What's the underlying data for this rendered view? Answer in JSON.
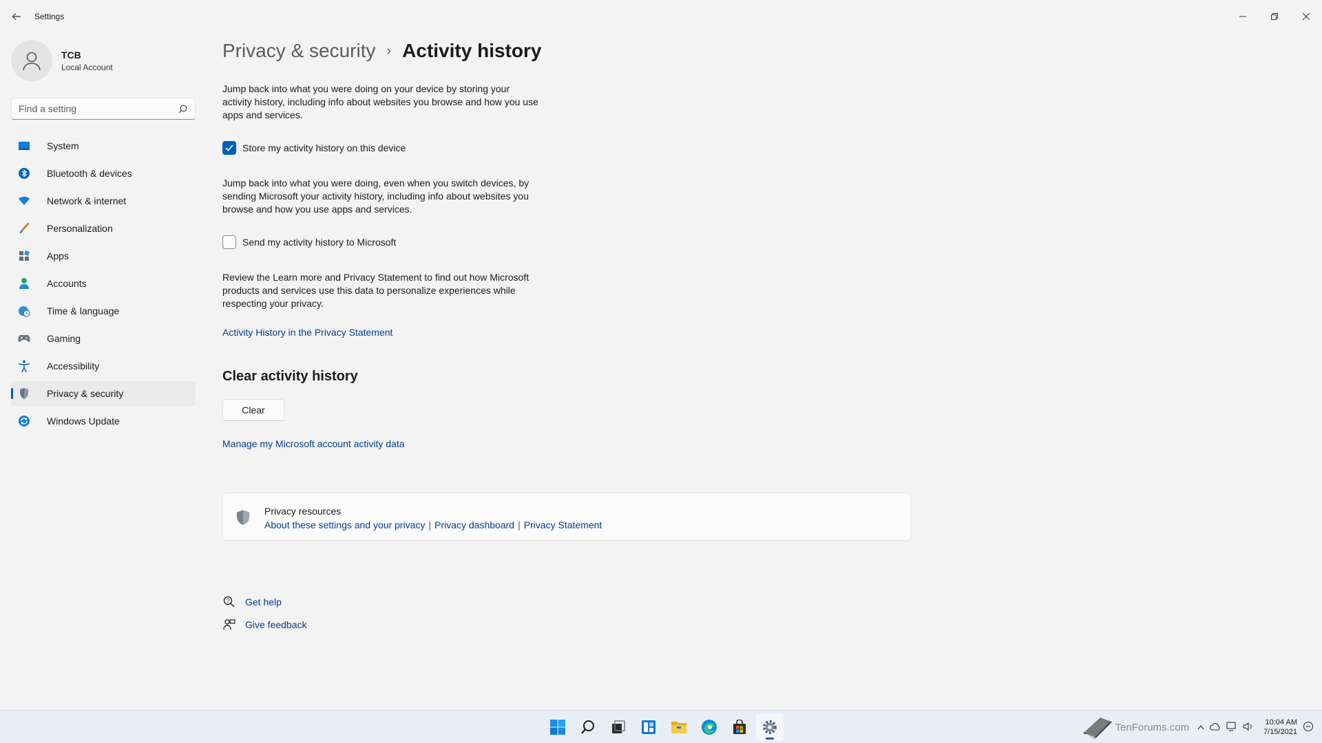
{
  "window": {
    "title": "Settings"
  },
  "profile": {
    "name": "TCB",
    "subtitle": "Local Account"
  },
  "search": {
    "placeholder": "Find a setting"
  },
  "sidebar": {
    "items": [
      {
        "label": "System",
        "icon": "system-icon",
        "active": false
      },
      {
        "label": "Bluetooth & devices",
        "icon": "bluetooth-icon",
        "active": false
      },
      {
        "label": "Network & internet",
        "icon": "wifi-icon",
        "active": false
      },
      {
        "label": "Personalization",
        "icon": "brush-icon",
        "active": false
      },
      {
        "label": "Apps",
        "icon": "apps-icon",
        "active": false
      },
      {
        "label": "Accounts",
        "icon": "accounts-icon",
        "active": false
      },
      {
        "label": "Time & language",
        "icon": "globe-clock-icon",
        "active": false
      },
      {
        "label": "Gaming",
        "icon": "gamepad-icon",
        "active": false
      },
      {
        "label": "Accessibility",
        "icon": "accessibility-icon",
        "active": false
      },
      {
        "label": "Privacy & security",
        "icon": "shield-icon",
        "active": true
      },
      {
        "label": "Windows Update",
        "icon": "update-icon",
        "active": false
      }
    ]
  },
  "breadcrumb": {
    "parent": "Privacy & security",
    "separator": "›",
    "current": "Activity history"
  },
  "main": {
    "para1": "Jump back into what you were doing on your device by storing your activity history, including info about websites you browse and how you use apps and services.",
    "checkbox1": {
      "label": "Store my activity history on this device",
      "checked": true
    },
    "para2": "Jump back into what you were doing, even when you switch devices, by sending Microsoft your activity history, including info about websites you browse and how you use apps and services.",
    "checkbox2": {
      "label": "Send my activity history to Microsoft",
      "checked": false
    },
    "para3": "Review the Learn more and Privacy Statement to find out how Microsoft products and services use this data to personalize experiences while respecting your privacy.",
    "privacy_link": "Activity History in the Privacy Statement",
    "clear_section_title": "Clear activity history",
    "clear_button": "Clear",
    "manage_link": "Manage my Microsoft account activity data"
  },
  "resources": {
    "title": "Privacy resources",
    "links": [
      "About these settings and your privacy",
      "Privacy dashboard",
      "Privacy Statement"
    ],
    "separator": "|"
  },
  "help": {
    "get_help": "Get help",
    "give_feedback": "Give feedback"
  },
  "taskbar": {
    "apps": [
      "start-icon",
      "search-icon",
      "task-view-icon",
      "widgets-icon",
      "file-explorer-icon",
      "edge-icon",
      "store-icon",
      "settings-icon"
    ],
    "watermark": "TenForums.com",
    "time": "10:04 AM",
    "date": "7/15/2021"
  },
  "colors": {
    "accent": "#005fb8",
    "link": "#003e92",
    "background": "#f3f3f3"
  }
}
